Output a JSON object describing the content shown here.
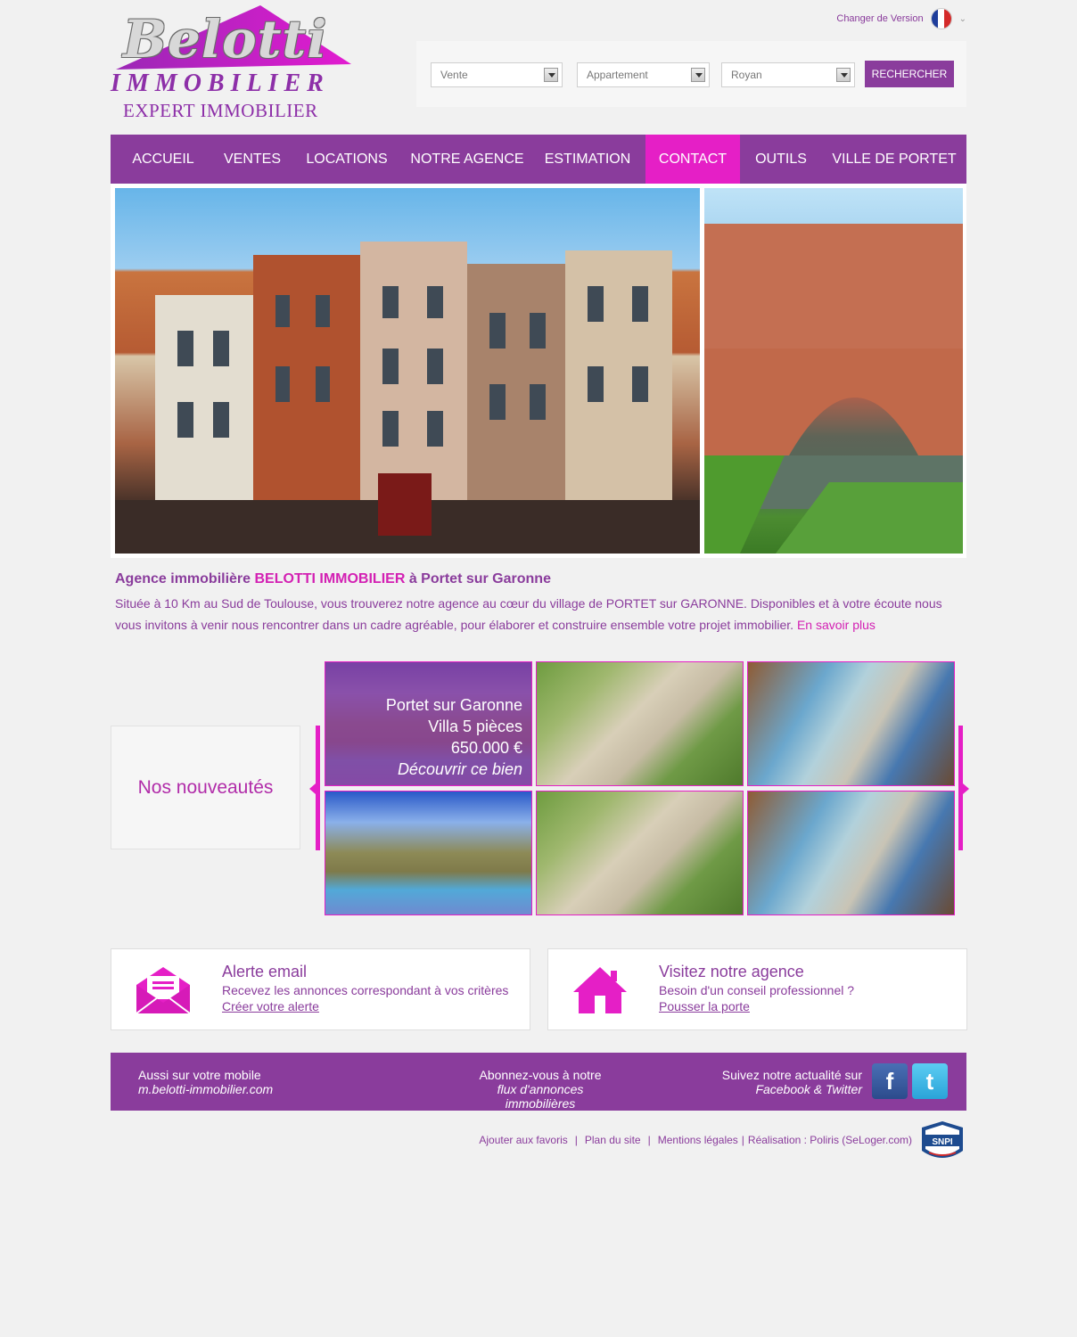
{
  "logo": {
    "script": "Belotti",
    "immobilier": "IMMOBILIER",
    "expert": "EXPERT IMMOBILIER"
  },
  "version": {
    "label": "Changer de Version"
  },
  "search": {
    "transaction": "Vente",
    "type": "Appartement",
    "city": "Royan",
    "button": "RECHERCHER"
  },
  "nav": {
    "items": [
      "ACCUEIL",
      "VENTES",
      "LOCATIONS",
      "NOTRE AGENCE",
      "ESTIMATION",
      "CONTACT",
      "OUTILS",
      "VILLE DE PORTET"
    ],
    "active": "CONTACT"
  },
  "intro": {
    "title_pre": "Agence immobilière ",
    "title_hl": "BELOTTI IMMOBILIER",
    "title_post": " à Portet sur Garonne",
    "text": "Située à 10 Km au Sud de Toulouse, vous trouverez notre agence au cœur du village de PORTET sur GARONNE. Disponibles et à votre écoute nous vous invitons à venir nous rencontrer dans un cadre agréable, pour élaborer et construire ensemble votre projet immobilier. ",
    "more": "En savoir plus"
  },
  "news": {
    "label": "Nos nouveautés",
    "featured": {
      "city": "Portet sur Garonne",
      "kind": "Villa 5 pièces",
      "price": "650.000 €",
      "cta": "Découvrir ce bien"
    }
  },
  "cards": {
    "alert": {
      "title": "Alerte email",
      "subtitle": "Recevez les annonces correspondant à vos critères",
      "link": "Créer votre alerte"
    },
    "visit": {
      "title": "Visitez notre agence",
      "subtitle": "Besoin d'un conseil professionnel ?",
      "link": "Pousser la porte"
    }
  },
  "footer_band": {
    "mobile_label": "Aussi sur votre mobile",
    "mobile_url": "m.belotti-immobilier.com",
    "rss_label": "Abonnez-vous à notre",
    "rss_sub": "flux d'annonces immobilières",
    "social_label": "Suivez notre actualité sur",
    "social_sub": "Facebook & Twitter",
    "facebook_glyph": "f",
    "twitter_glyph": "t"
  },
  "footer_links": {
    "favorites": "Ajouter aux favoris",
    "sitemap": "Plan du site",
    "legal": "Mentions légales",
    "credit": "Réalisation : Poliris (SeLoger.com)",
    "snpi": "SNPI"
  },
  "colors": {
    "brand_purple": "#8a3c9c",
    "accent_pink": "#e51fc6",
    "background": "#f1f1f1"
  }
}
